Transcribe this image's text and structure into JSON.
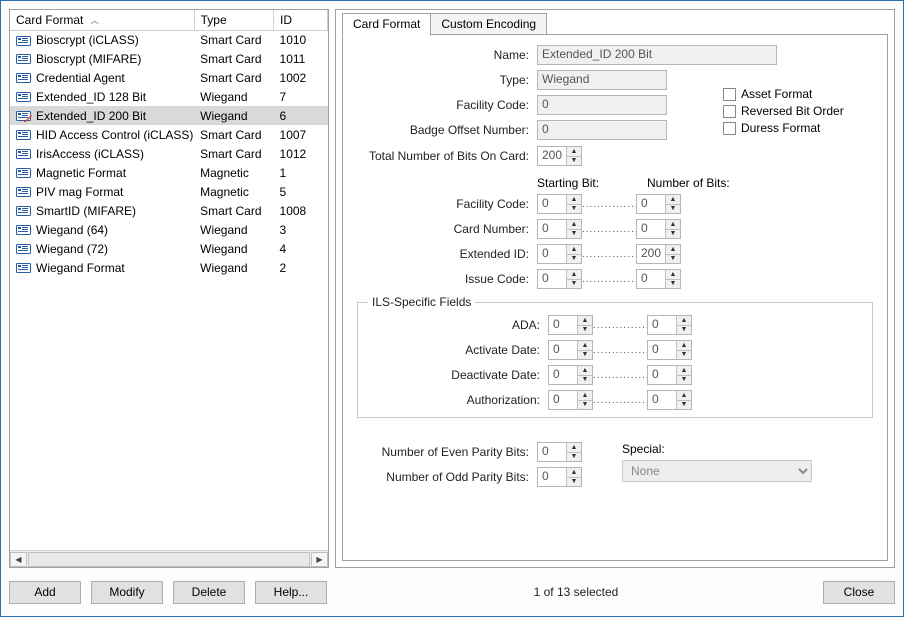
{
  "list": {
    "columns": [
      "Card Format",
      "Type",
      "ID"
    ],
    "sort_asc": true,
    "rows": [
      {
        "name": "Bioscrypt (iCLASS)",
        "type": "Smart Card",
        "id": "1010",
        "icon": "card"
      },
      {
        "name": "Bioscrypt (MIFARE)",
        "type": "Smart Card",
        "id": "1011",
        "icon": "card"
      },
      {
        "name": "Credential Agent",
        "type": "Smart Card",
        "id": "1002",
        "icon": "card"
      },
      {
        "name": "Extended_ID 128 Bit",
        "type": "Wiegand",
        "id": "7",
        "icon": "card"
      },
      {
        "name": "Extended_ID 200 Bit",
        "type": "Wiegand",
        "id": "6",
        "icon": "card-edit",
        "selected": true
      },
      {
        "name": "HID Access Control (iCLASS)",
        "type": "Smart Card",
        "id": "1007",
        "icon": "card"
      },
      {
        "name": "IrisAccess (iCLASS)",
        "type": "Smart Card",
        "id": "1012",
        "icon": "card"
      },
      {
        "name": "Magnetic Format",
        "type": "Magnetic",
        "id": "1",
        "icon": "card"
      },
      {
        "name": "PIV mag Format",
        "type": "Magnetic",
        "id": "5",
        "icon": "card"
      },
      {
        "name": "SmartID (MIFARE)",
        "type": "Smart Card",
        "id": "1008",
        "icon": "card"
      },
      {
        "name": "Wiegand (64)",
        "type": "Wiegand",
        "id": "3",
        "icon": "card"
      },
      {
        "name": "Wiegand (72)",
        "type": "Wiegand",
        "id": "4",
        "icon": "card"
      },
      {
        "name": "Wiegand Format",
        "type": "Wiegand",
        "id": "2",
        "icon": "card"
      }
    ]
  },
  "tabs": {
    "card_format": "Card Format",
    "custom_encoding": "Custom Encoding"
  },
  "form": {
    "name_label": "Name:",
    "name_value": "Extended_ID 200 Bit",
    "type_label": "Type:",
    "type_value": "Wiegand",
    "facility_code_label": "Facility Code:",
    "facility_code_value": "0",
    "badge_offset_label": "Badge Offset Number:",
    "badge_offset_value": "0",
    "total_bits_label": "Total Number of Bits On Card:",
    "total_bits_value": "200",
    "asset_format": "Asset Format",
    "reversed_bit": "Reversed Bit Order",
    "duress": "Duress Format",
    "starting_bit": "Starting Bit:",
    "number_of_bits": "Number of Bits:",
    "fc_label": "Facility Code:",
    "fc_start": "0",
    "fc_bits": "0",
    "cn_label": "Card Number:",
    "cn_start": "0",
    "cn_bits": "0",
    "eid_label": "Extended ID:",
    "eid_start": "0",
    "eid_bits": "200",
    "ic_label": "Issue Code:",
    "ic_start": "0",
    "ic_bits": "0",
    "ils_legend": "ILS-Specific Fields",
    "ada_label": "ADA:",
    "ada_start": "0",
    "ada_bits": "0",
    "act_label": "Activate Date:",
    "act_start": "0",
    "act_bits": "0",
    "deact_label": "Deactivate Date:",
    "deact_start": "0",
    "deact_bits": "0",
    "auth_label": "Authorization:",
    "auth_start": "0",
    "auth_bits": "0",
    "even_parity_label": "Number of Even Parity Bits:",
    "even_parity_value": "0",
    "odd_parity_label": "Number of Odd Parity Bits:",
    "odd_parity_value": "0",
    "special_label": "Special:",
    "special_value": "None"
  },
  "buttons": {
    "add": "Add",
    "modify": "Modify",
    "delete": "Delete",
    "help": "Help...",
    "close": "Close"
  },
  "status": "1 of 13 selected"
}
